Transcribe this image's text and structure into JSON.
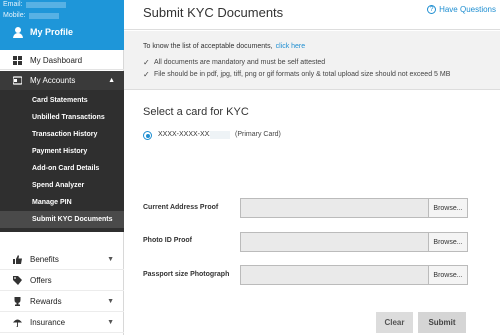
{
  "profile": {
    "email_label": "Email:",
    "mobile_label": "Mobile:",
    "title": "My Profile"
  },
  "nav": {
    "dashboard": "My Dashboard",
    "accounts": "My Accounts",
    "submenu": [
      "Card Statements",
      "Unbilled Transactions",
      "Transaction History",
      "Payment History",
      "Add-on Card Details",
      "Spend Analyzer",
      "Manage PIN",
      "Submit KYC Documents"
    ],
    "benefits": "Benefits",
    "offers": "Offers",
    "rewards": "Rewards",
    "insurance": "Insurance"
  },
  "header": {
    "title": "Submit KYC Documents",
    "help": "Have Questions"
  },
  "info": {
    "know_text": "To know the list of acceptable documents,",
    "know_link": "click here",
    "bullets": [
      "All documents are mandatory and must be self attested",
      "File should be in pdf, jpg, tiff, png or gif formats only & total upload size should not exceed 5 MB"
    ]
  },
  "card_select": {
    "title": "Select a card for KYC",
    "card_number": "XXXX-XXXX-XXXX-",
    "card_type": "(Primary Card)"
  },
  "uploads": [
    {
      "label": "Current Address Proof",
      "button": "Browse..."
    },
    {
      "label": "Photo ID Proof",
      "button": "Browse..."
    },
    {
      "label": "Passport size Photograph",
      "button": "Browse..."
    }
  ],
  "actions": {
    "clear": "Clear",
    "submit": "Submit"
  }
}
